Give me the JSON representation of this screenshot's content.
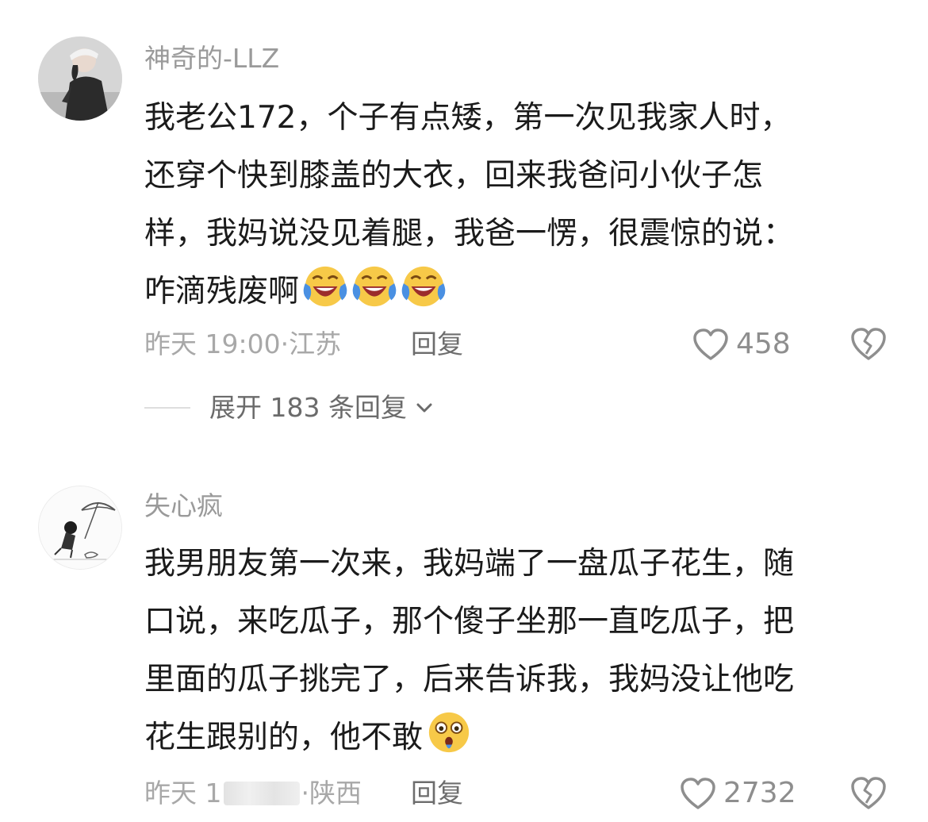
{
  "comments": [
    {
      "username": "神奇的-LLZ",
      "lines": [
        "我老公172，个子有点矮，第一次见我家人时，",
        "还穿个快到膝盖的大衣，回来我爸问小伙子怎",
        "样，我妈说没见着腿，我爸一愣，很震惊的说：",
        "咋滴残废啊"
      ],
      "emojis": [
        "crying-laughing-emoji",
        "crying-laughing-emoji",
        "crying-laughing-emoji"
      ],
      "time": "昨天 19:00",
      "location": "江苏",
      "reply_label": "回复",
      "likes": "458",
      "expand_label": "展开 183 条回复"
    },
    {
      "username": "失心疯",
      "lines": [
        "我男朋友第一次来，我妈端了一盘瓜子花生，随",
        "口说，来吃瓜子，那个傻子坐那一直吃瓜子，把",
        "里面的瓜子挑完了，后来告诉我，我妈没让他吃",
        "花生跟别的，他不敢"
      ],
      "emojis": [
        "shocked-emoji"
      ],
      "time_prefix": "昨天 1",
      "location": "陕西",
      "reply_label": "回复",
      "likes": "2732"
    }
  ],
  "colors": {
    "text": "#1b1b1b",
    "meta": "#a8a8a8",
    "username": "#9a9a9a",
    "emoji_yellow": "#f7c948",
    "emoji_blue": "#4a90e2"
  }
}
